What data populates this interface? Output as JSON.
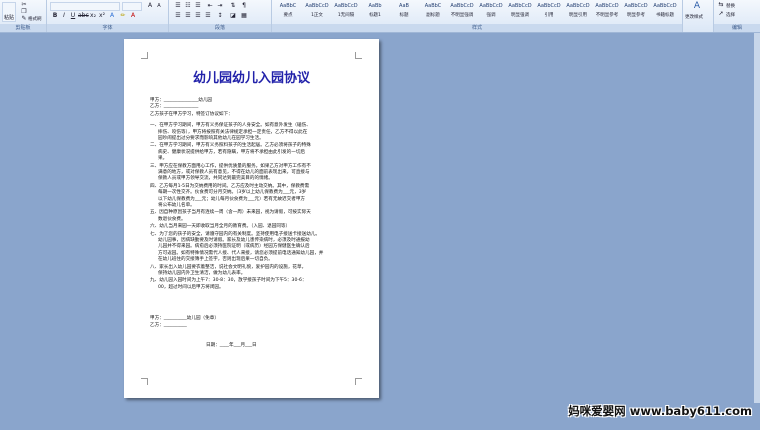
{
  "ribbon": {
    "clipboard_label": "剪贴板",
    "font_label": "字体",
    "paragraph_label": "段落",
    "styles_label": "样式",
    "editing_label": "编辑",
    "paste_label": "粘贴",
    "format_painter_label": "格式刷",
    "change_styles_label": "更改样式",
    "replace_label": "替换",
    "select_label": "选择",
    "styles": [
      "要点",
      "1正文",
      "1无间隔",
      "标题1",
      "标题",
      "副标题",
      "不明显强调",
      "强调",
      "明显强调",
      "引用",
      "明显引用",
      "不明显参考",
      "明显参考",
      "书籍标题"
    ],
    "style_previews": [
      "AaBbC",
      "AaBbCcD",
      "AaBbCcD",
      "AaBb",
      "AaB",
      "AaBbC",
      "AaBbCcD",
      "AaBbCcD",
      "AaBbCcD",
      "AaBbCcD",
      "AaBbCcD",
      "AaBbCcD",
      "AaBbCcD",
      "AaBbCcD"
    ]
  },
  "document": {
    "title": "幼儿园幼儿入园协议",
    "lines": [
      "甲方：_______________幼儿园",
      "乙方：_______________",
      "乙方孩子在甲方学习，特签订协议如下：",
      "一、在甲方学习期间，甲方有义务保证孩子的人身安全。如有意外发生（磕伤、",
      "摔伤、咬伤等），甲方将按照有关法律规定承担一定责任，乙方不得以此在",
      "园吵闹提出过分要求而影响其他幼儿在园学习生活。",
      "二、在甲方学习期间，甲方有义务照料孩子的生活起居。乙方必须将孩子的特殊",
      "病史、健康状况提供给甲方，若有隐瞒，甲方将不承担由此引发的一切后",
      "果。",
      "三、甲方应在保教方面用心工作，提供优质量的服务。如果乙方对甲方工作有不",
      "满意的地方，或对保教人员有意见，不得在幼儿的面前表现出来，可直接与",
      "保教人员或甲方领导交流，共同达到最完美目的的情绪。",
      "四、乙方每月1-5日为交纳费用的时间。乙方应及时主动交纳。其中，保教费需",
      "每期一次性交齐。伙食费可分月交纳。（3岁以上幼儿保教费为___元，3岁",
      "以下幼儿保教费为___元；幼儿每月伙食费为___元）若有无故迟交者甲方",
      "将公布幼儿名单。",
      "五、因自种原因孩子当月有连续一周（含一周）未来园，视为请假，可按实际天",
      "数退伙食费。",
      "六、幼儿当月来园一天即收取当月全月的教育费。（入园、退园同等）",
      "七、为了您的孩子的安全，请遵守园内的有关制度。坚持使用电子接送卡接送幼儿。",
      "幼儿园事，因病缺勤要及时请假。家长及幼儿患传染病时，必须及时通报幼",
      "儿园并不得来园。病愈后必须持医院证明（或病历）经园方保健医生确认后",
      "方可返园。如有特殊情况需代人接、代人来接，请您必须提前电话通知幼儿园，并",
      "在幼儿班住的交接簿手上签字，否则出现后果一切自负。",
      "八、家长出入幼儿园要衣着整洁，说社会文明礼貌，爱护园内的设施，花草，",
      "保持幼儿园内外卫生清洁，做为幼儿表率。",
      "九、幼儿园入园时间为上午7：30-8：30，放学接孩子时间为下午5：30-6：",
      "00，超过时间以后甲方将闭园。",
      "甲方：__________幼儿园（免章）",
      "乙方：__________",
      "日期：____年___月___日"
    ]
  },
  "watermark": "妈咪爱婴网 www.baby611.com"
}
